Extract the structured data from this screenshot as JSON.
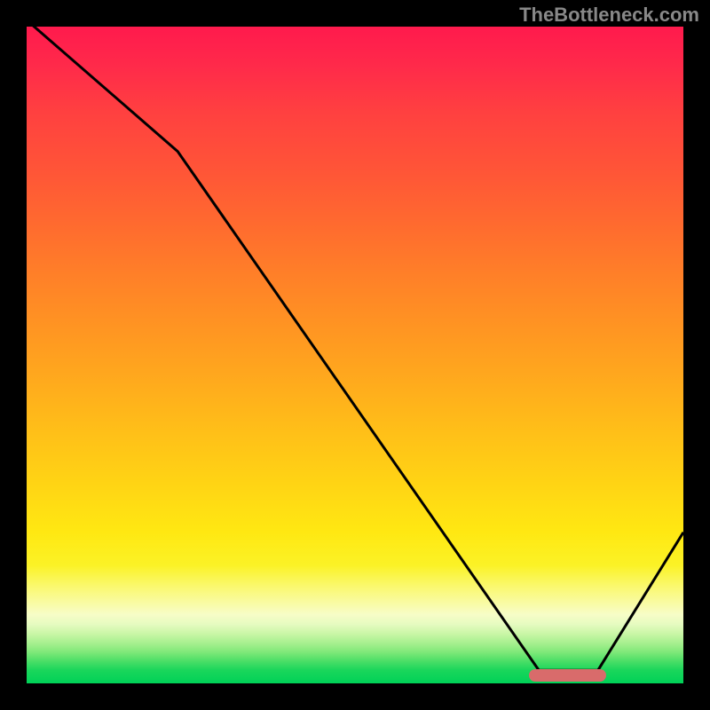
{
  "watermark": "TheBottleneck.com",
  "chart_data": {
    "type": "line",
    "title": "",
    "xlabel": "",
    "ylabel": "",
    "xlim": [
      0,
      100
    ],
    "ylim": [
      0,
      100
    ],
    "x": [
      0,
      23,
      78,
      87,
      100
    ],
    "values": [
      101,
      81,
      2,
      2,
      23
    ],
    "marker": {
      "x_start": 76.5,
      "x_end": 88.2,
      "y": 1.2
    },
    "gradient_stops": [
      {
        "pos": 0,
        "color": "#ff1a4d"
      },
      {
        "pos": 50,
        "color": "#ffaa1d"
      },
      {
        "pos": 85,
        "color": "#faf86a"
      },
      {
        "pos": 100,
        "color": "#00d157"
      }
    ]
  }
}
